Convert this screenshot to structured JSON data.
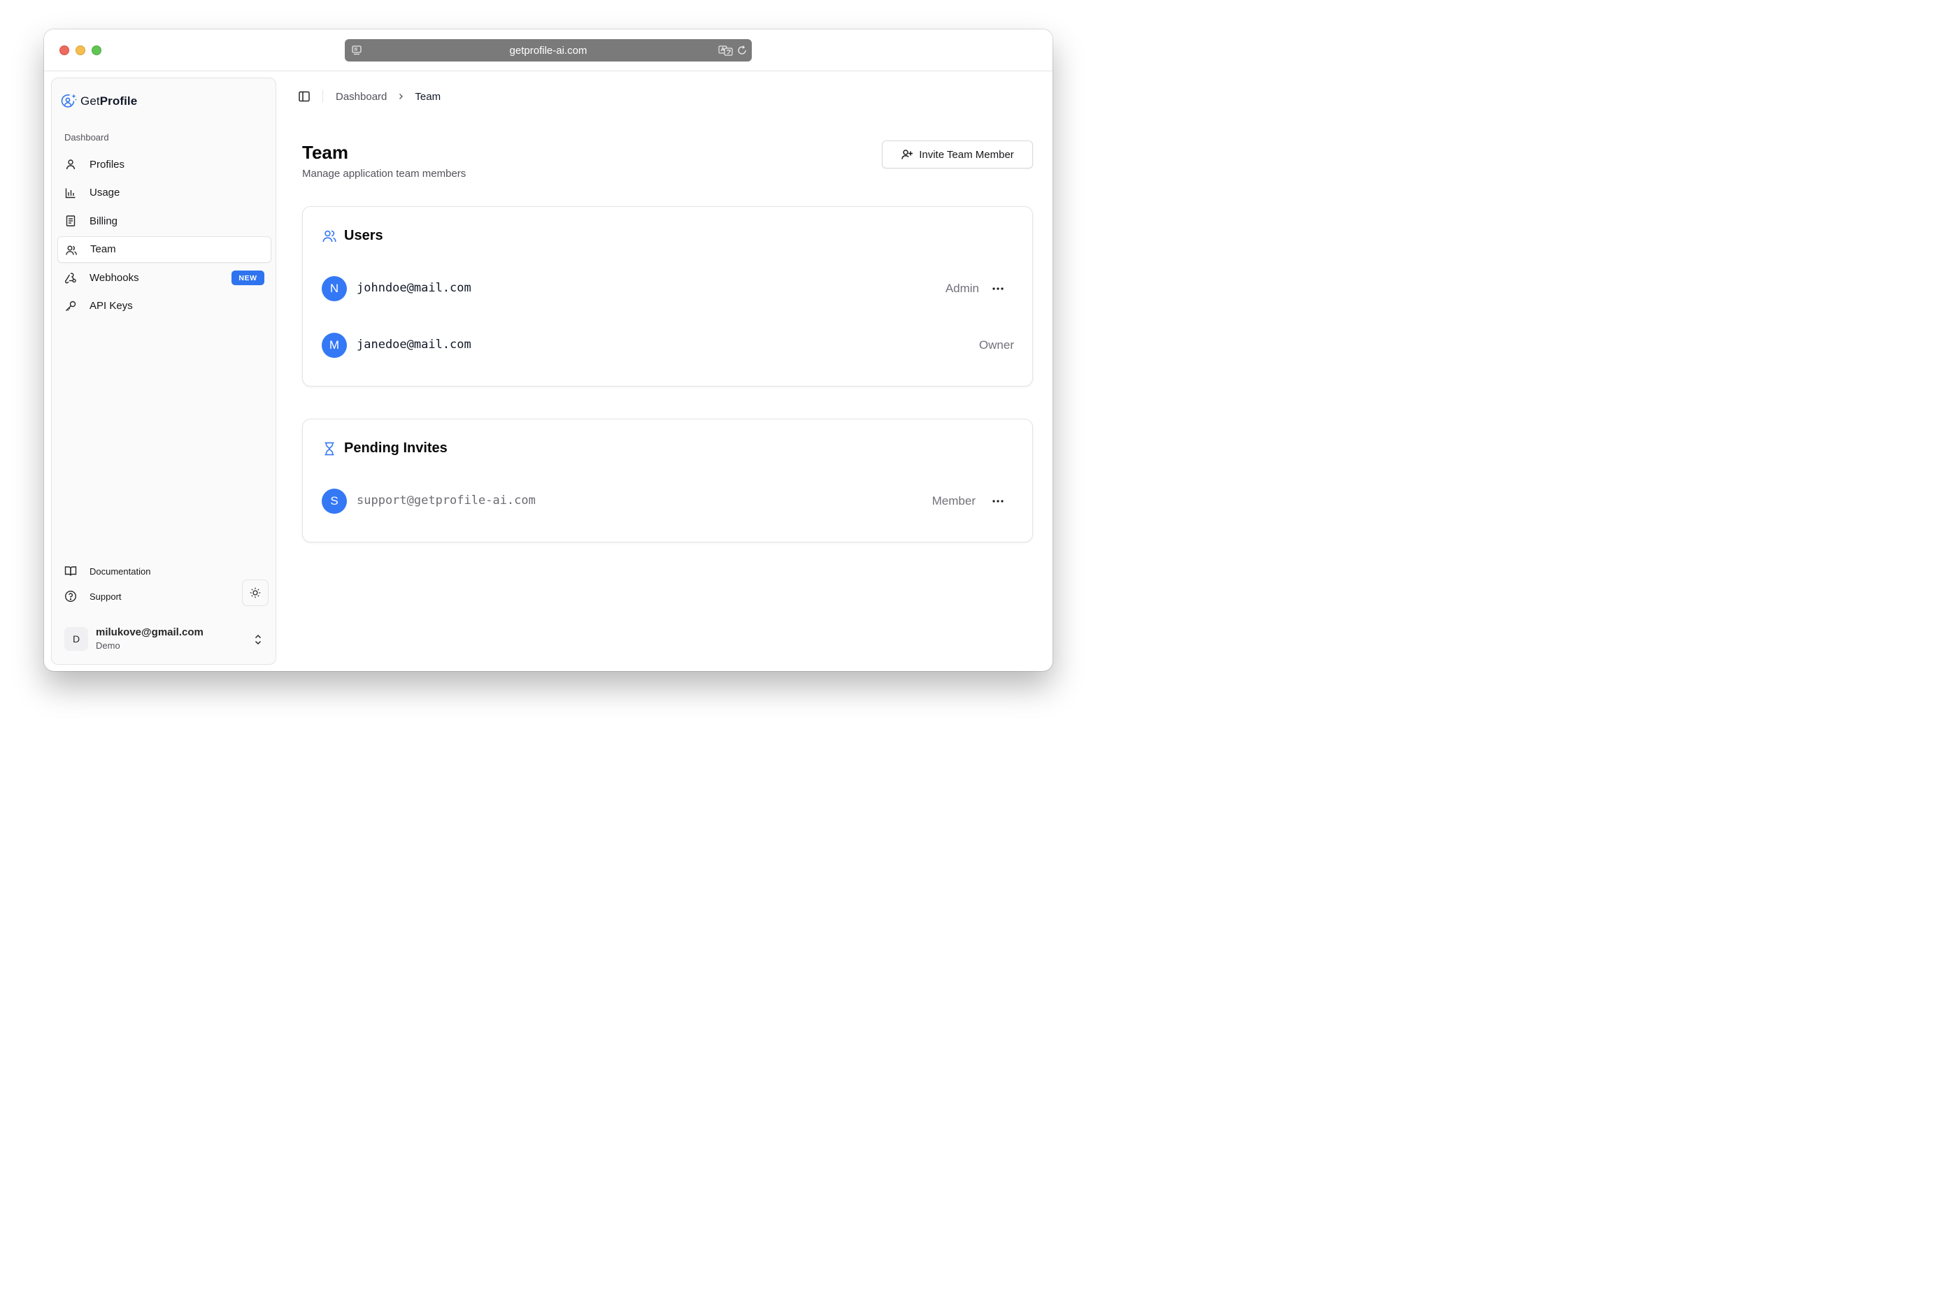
{
  "browser": {
    "url": "getprofile-ai.com"
  },
  "sidebar": {
    "brand": {
      "prefix": "Get",
      "bold": "Profile"
    },
    "section_label": "Dashboard",
    "items": [
      {
        "label": "Profiles",
        "icon": "user-icon"
      },
      {
        "label": "Usage",
        "icon": "bar-chart-icon"
      },
      {
        "label": "Billing",
        "icon": "receipt-icon"
      },
      {
        "label": "Team",
        "icon": "users-icon",
        "active": true
      },
      {
        "label": "Webhooks",
        "icon": "webhook-icon",
        "badge": "NEW"
      },
      {
        "label": "API Keys",
        "icon": "key-icon"
      }
    ],
    "footer": {
      "documentation": "Documentation",
      "support": "Support"
    },
    "user": {
      "initial": "D",
      "email": "milukove@gmail.com",
      "plan": "Demo"
    }
  },
  "breadcrumb": {
    "parent": "Dashboard",
    "current": "Team"
  },
  "page": {
    "title": "Team",
    "subtitle": "Manage application team members",
    "invite_button": "Invite Team Member"
  },
  "users_card": {
    "title": "Users",
    "rows": [
      {
        "initial": "N",
        "email": "johndoe@mail.com",
        "role": "Admin",
        "has_menu": true
      },
      {
        "initial": "M",
        "email": "janedoe@mail.com",
        "role": "Owner",
        "has_menu": false
      }
    ]
  },
  "pending_card": {
    "title": "Pending Invites",
    "rows": [
      {
        "initial": "S",
        "email": "support@getprofile-ai.com",
        "role": "Member",
        "has_menu": true
      }
    ]
  },
  "colors": {
    "accent": "#3478f6",
    "badge": "#2f74ee",
    "muted_text": "#71717a"
  }
}
